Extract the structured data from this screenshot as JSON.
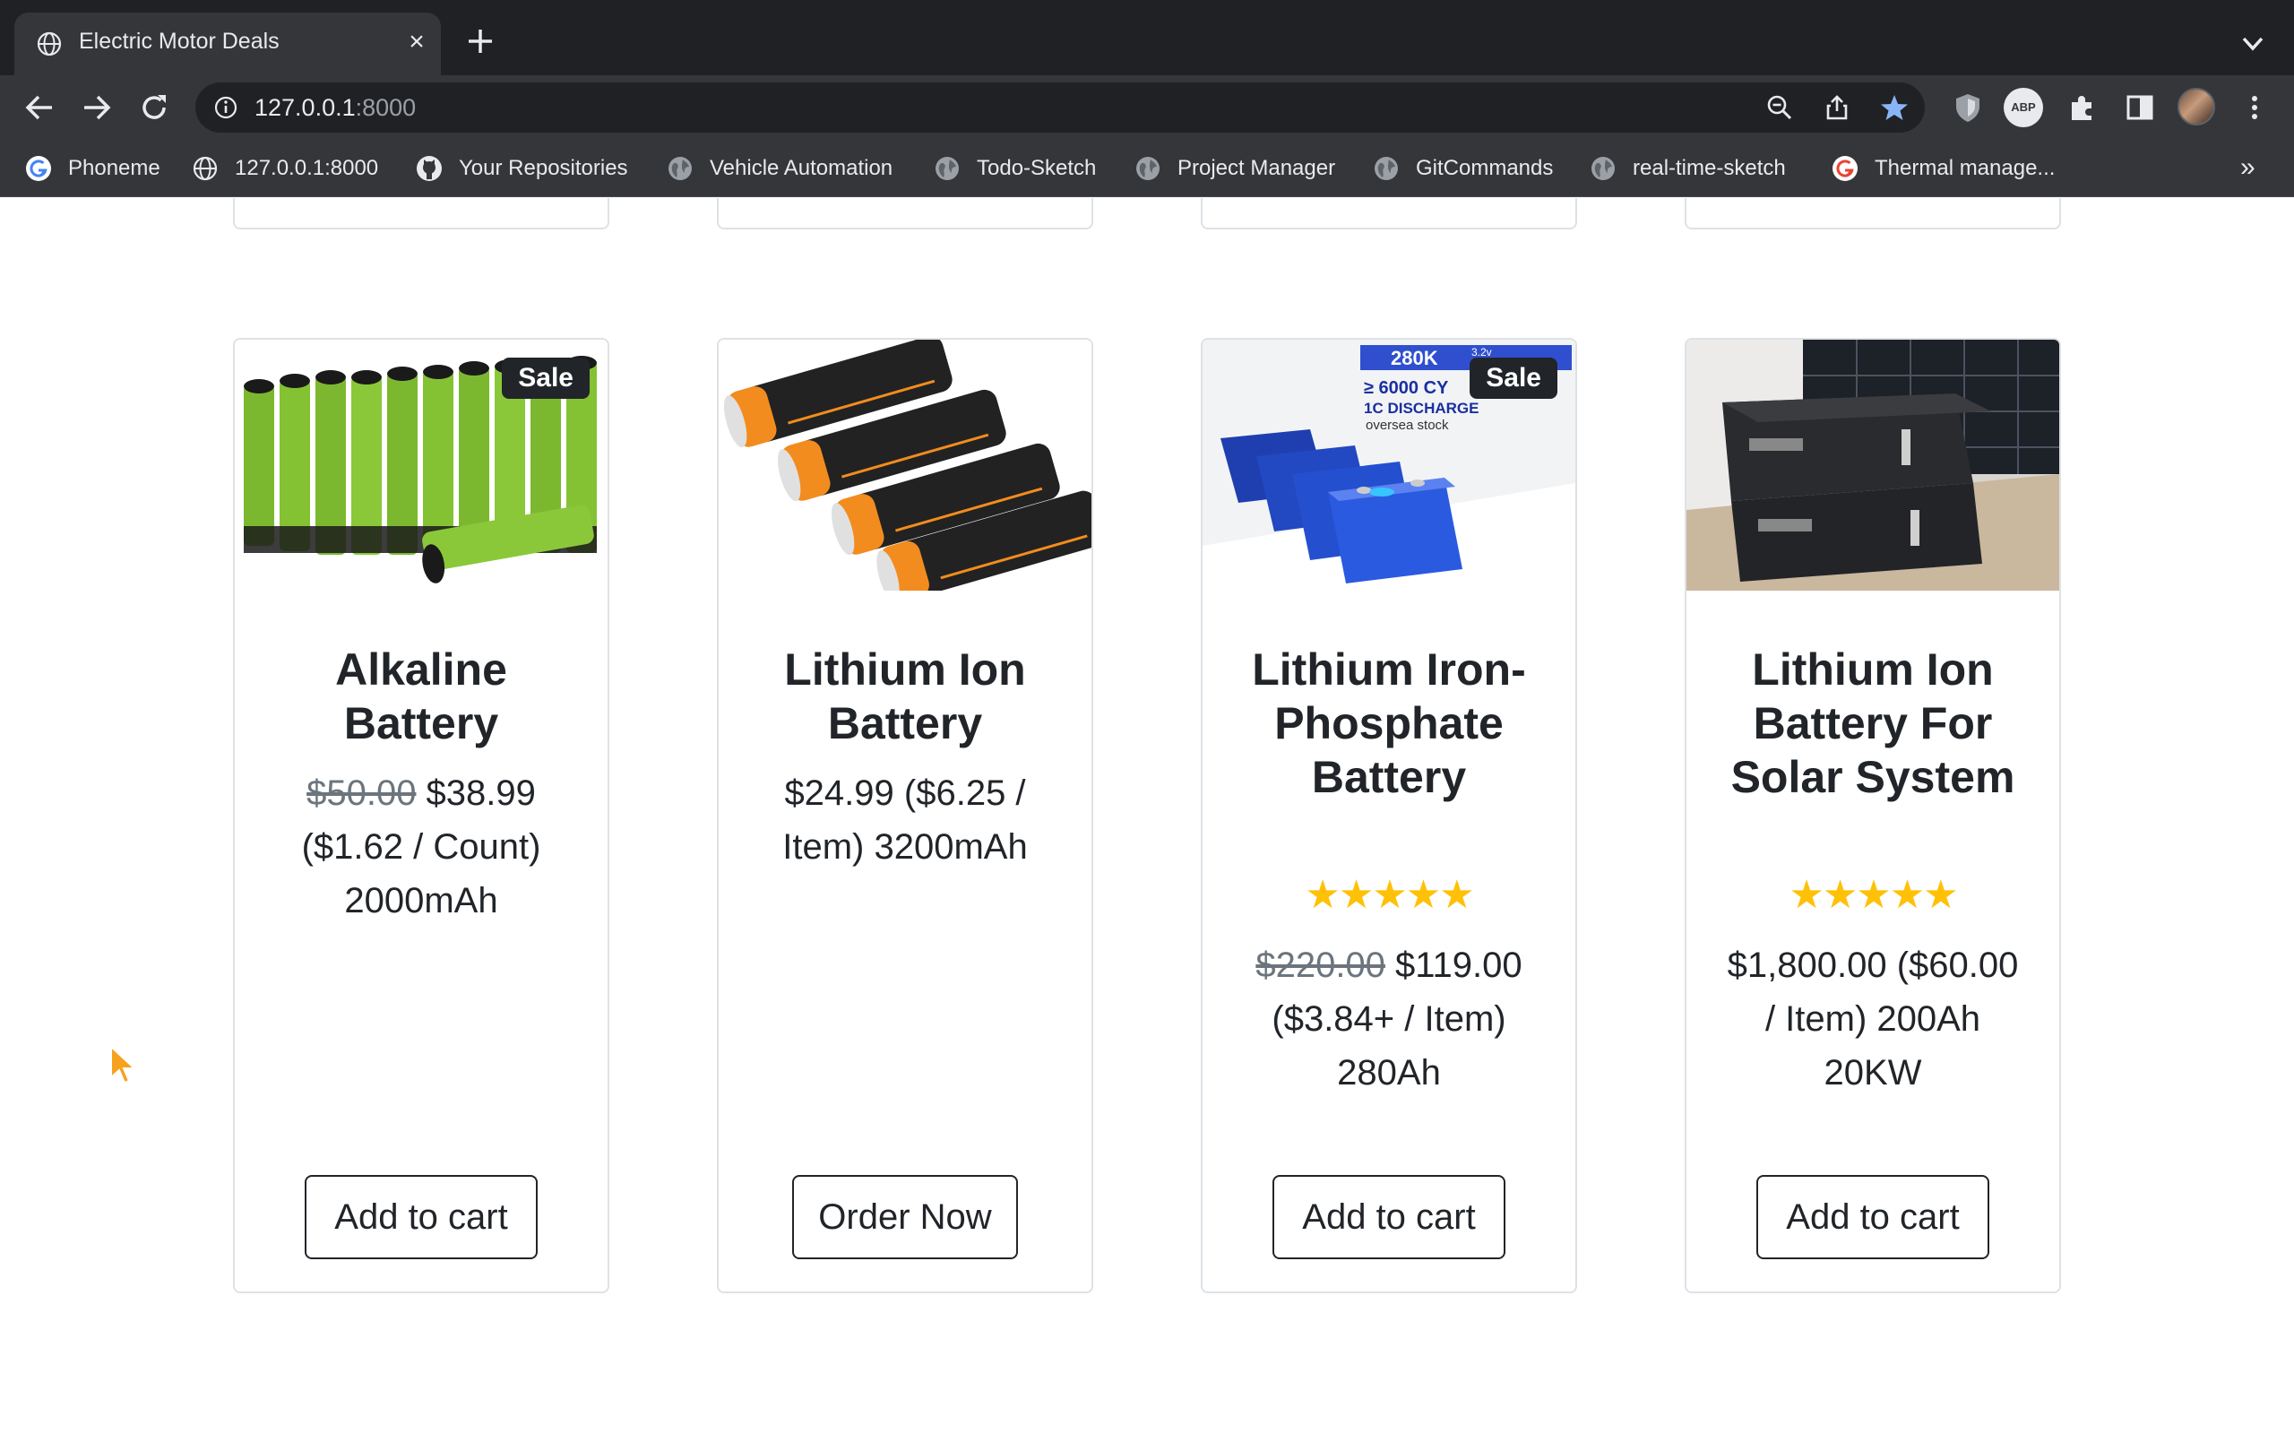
{
  "browser": {
    "tab_title": "Electric Motor Deals",
    "tab_close": "×",
    "url_host": "127.0.0.1",
    "url_port": ":8000",
    "bookmarks": [
      {
        "label": "Phoneme",
        "icon": "google-icon"
      },
      {
        "label": "127.0.0.1:8000",
        "icon": "globe-icon"
      },
      {
        "label": "Your Repositories",
        "icon": "github-icon"
      },
      {
        "label": "Vehicle Automation",
        "icon": "globe-dark-icon"
      },
      {
        "label": "Todo-Sketch",
        "icon": "globe-dark-icon"
      },
      {
        "label": "Project Manager",
        "icon": "globe-dark-icon"
      },
      {
        "label": "GitCommands",
        "icon": "globe-dark-icon"
      },
      {
        "label": "real-time-sketch",
        "icon": "globe-dark-icon"
      },
      {
        "label": "Thermal manage...",
        "icon": "google-icon"
      }
    ],
    "bookmarks_more": "»",
    "abp_label": "ABP"
  },
  "products": [
    {
      "title": "Alkaline Battery",
      "badge": "Sale",
      "rating": "",
      "price_old": "$50.00",
      "price_text": " $38.99 ($1.62 / Count) 2000mAh",
      "button": "Add to cart",
      "image": "aa-batteries-photo"
    },
    {
      "title": "Lithium Ion Battery",
      "badge": "",
      "rating": "",
      "price_old": "",
      "price_text": "$24.99 ($6.25 / Item) 3200mAh",
      "button": "Order Now",
      "image": "cbjj-18650-photo"
    },
    {
      "title": "Lithium Iron-Phosphate Battery",
      "badge": "Sale",
      "rating": "★★★★★",
      "rating_value": 5,
      "price_old": "$220.00",
      "price_text": " $119.00 ($3.84+ / Item) 280Ah",
      "button": "Add to cart",
      "image": "lifepo4-cells-photo",
      "image_text": {
        "banner": "280K",
        "voltage": "3.2v",
        "cycles": "≥ 6000 CY",
        "discharge": "1C DISCHARGE",
        "stock": "oversea stock"
      }
    },
    {
      "title": "Lithium Ion Battery For Solar System",
      "badge": "",
      "rating": "★★★★★",
      "rating_value": 5,
      "price_old": "",
      "price_text": "$1,800.00 ($60.00 / Item) 200Ah 20KW",
      "button": "Add to cart",
      "image": "rack-battery-photo"
    }
  ],
  "colors": {
    "chrome_dark": "#202124",
    "chrome_toolbar": "#35363a",
    "star": "#ffc107",
    "star_bookmark": "#8ab4f8",
    "text": "#212529",
    "muted": "#6c757d"
  }
}
